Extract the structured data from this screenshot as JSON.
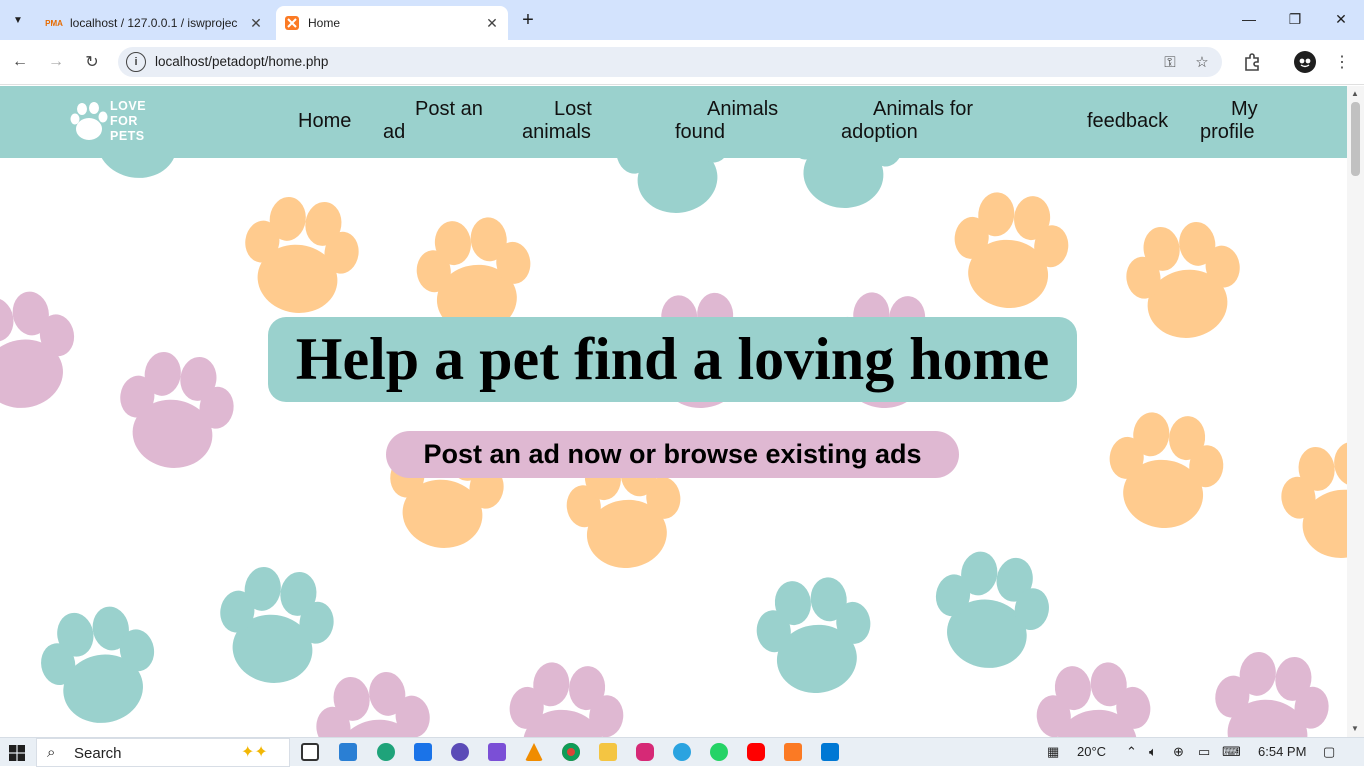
{
  "browser": {
    "tabs": [
      {
        "title": "localhost / 127.0.0.1 / iswprojec",
        "active": false
      },
      {
        "title": "Home",
        "active": true
      }
    ],
    "url": "localhost/petadopt/home.php"
  },
  "site": {
    "logo_lines": [
      "LOVE",
      "FOR",
      "PETS"
    ],
    "nav": [
      {
        "line1": "Home",
        "line2": ""
      },
      {
        "line1": "Post an",
        "line2": "ad"
      },
      {
        "line1": "Lost",
        "line2": "animals"
      },
      {
        "line1": "Animals",
        "line2": "found"
      },
      {
        "line1": "Animals for",
        "line2": "adoption"
      },
      {
        "line1": "feedback",
        "line2": ""
      },
      {
        "line1": "My",
        "line2": "profile"
      }
    ],
    "hero_title": "Help a pet find a loving home",
    "hero_subtitle": "Post an ad now or browse existing ads",
    "colors": {
      "teal": "#9ad1cd",
      "orange": "#ffcb8e",
      "pink": "#dfb8d2"
    }
  },
  "taskbar": {
    "search_label": "Search",
    "weather": "20°C",
    "time": "6:54 PM"
  }
}
